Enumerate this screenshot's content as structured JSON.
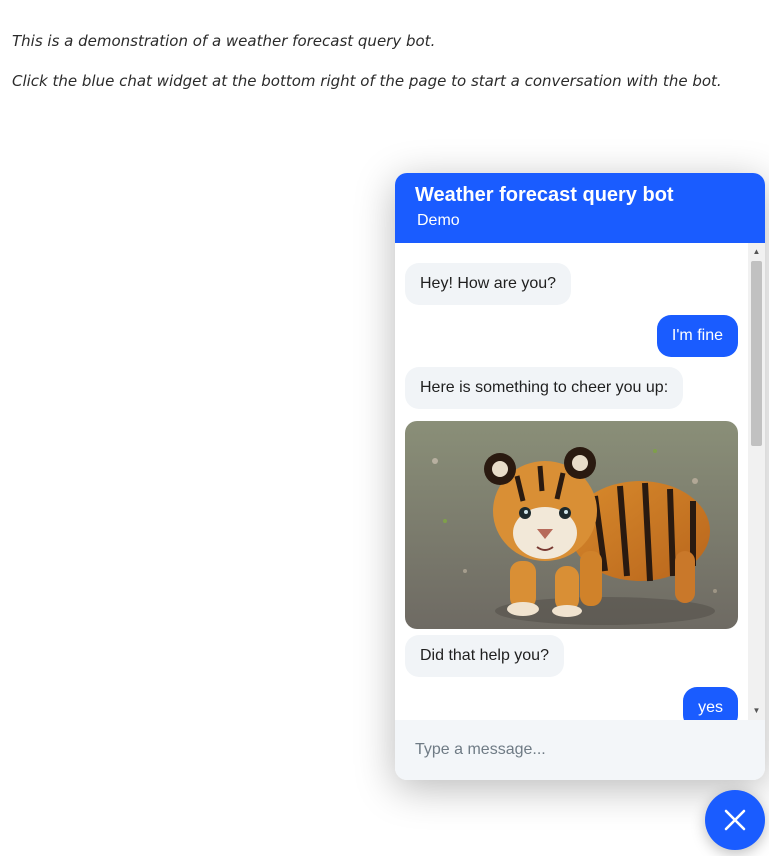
{
  "page": {
    "intro_line_1": "This is a demonstration of a weather forecast query bot.",
    "intro_line_2": "Click the blue chat widget at the bottom right of the page to start a conversation with the bot."
  },
  "widget": {
    "title": "Weather forecast query bot",
    "subtitle": "Demo",
    "accent_color": "#1a5cff",
    "messages": [
      {
        "from": "bot",
        "text": "Hey! How are you?"
      },
      {
        "from": "user",
        "text": "I'm fine"
      },
      {
        "from": "bot",
        "text": "Here is something to cheer you up:"
      },
      {
        "from": "bot",
        "type": "image",
        "image": "tiger-cub-photo"
      },
      {
        "from": "bot",
        "text": "Did that help you?"
      },
      {
        "from": "user",
        "text": "yes"
      }
    ],
    "composer": {
      "placeholder": "Type a message..."
    },
    "launcher_icon": "close-icon"
  }
}
